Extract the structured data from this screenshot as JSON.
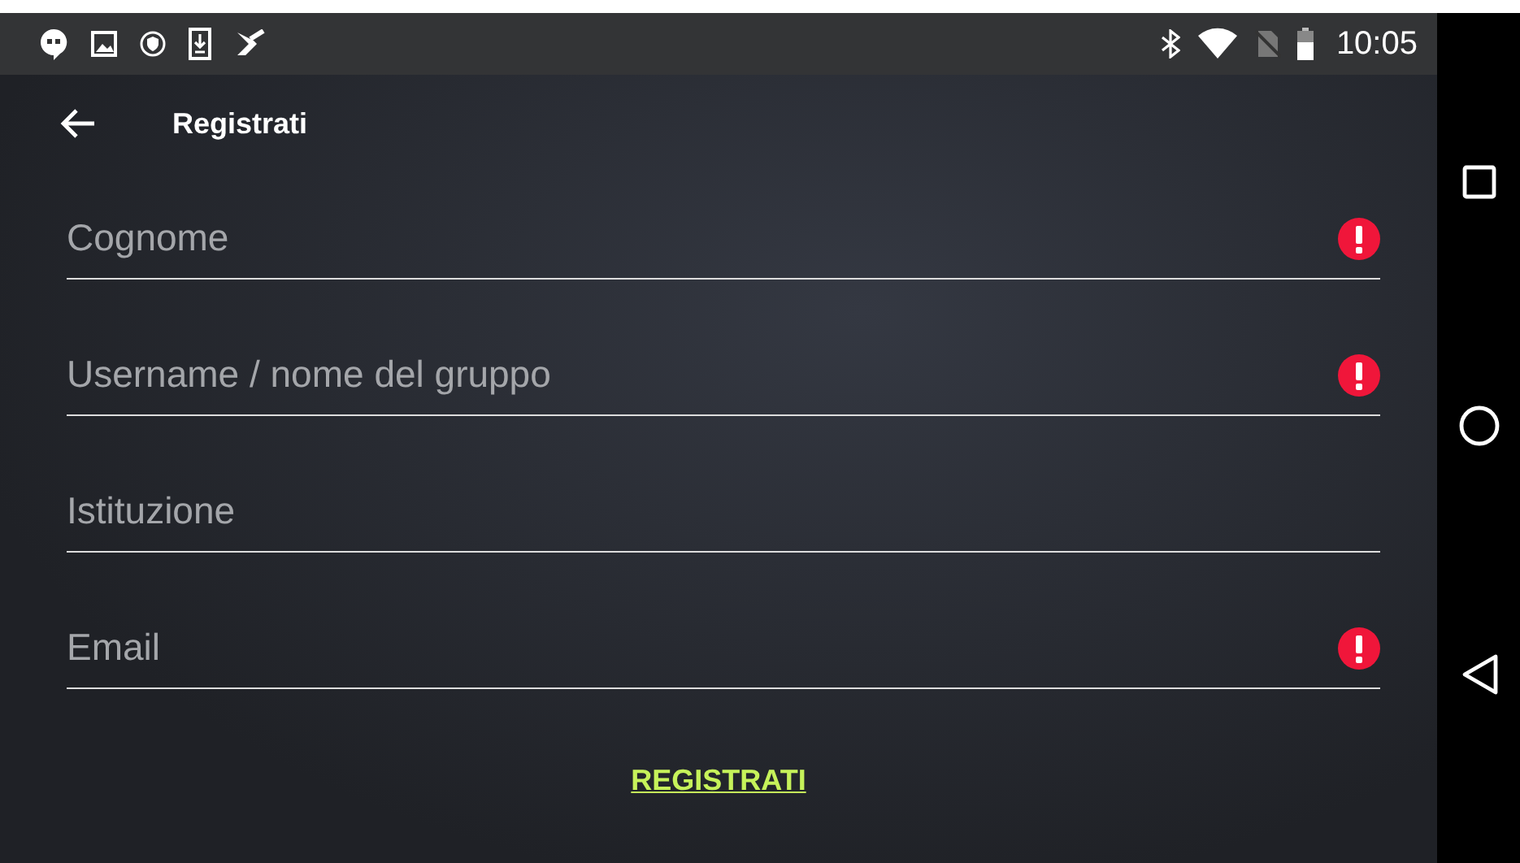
{
  "status_bar": {
    "time": "10:05"
  },
  "toolbar": {
    "title": "Registrati"
  },
  "fields": [
    {
      "placeholder": "Cognome",
      "error": true
    },
    {
      "placeholder": "Username / nome del gruppo",
      "error": true
    },
    {
      "placeholder": "Istituzione",
      "error": false
    },
    {
      "placeholder": "Email",
      "error": true
    }
  ],
  "submit_button": {
    "label": "REGISTRATI"
  }
}
